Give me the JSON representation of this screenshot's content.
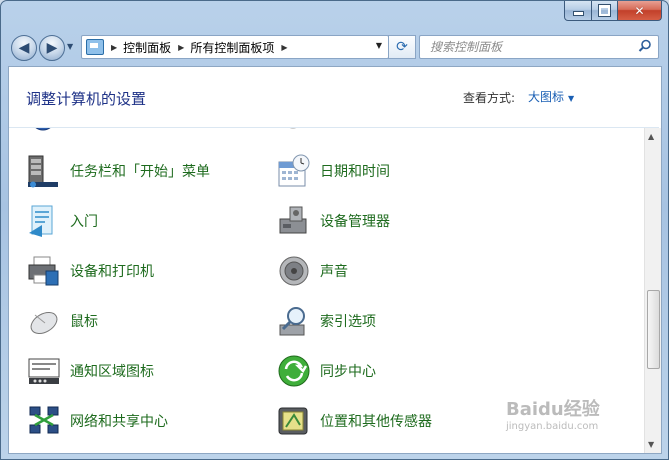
{
  "window": {
    "controls": {
      "minimize": "minimize-icon",
      "maximize": "maximize-icon",
      "close": "close-icon"
    }
  },
  "navigation": {
    "back_icon": "back-arrow-icon",
    "forward_icon": "forward-arrow-icon",
    "breadcrumb": [
      "控制面板",
      "所有控制面板项"
    ],
    "search_placeholder": "搜索控制面板"
  },
  "header": {
    "title": "调整计算机的设置",
    "view_by_label": "查看方式:",
    "view_by_value": "大图标"
  },
  "items": [
    {
      "label": "任务栏和「开始」菜单",
      "icon": "taskbar-icon"
    },
    {
      "label": "日期和时间",
      "icon": "calendar-clock-icon"
    },
    {
      "label": "入门",
      "icon": "getting-started-icon"
    },
    {
      "label": "设备管理器",
      "icon": "device-manager-icon"
    },
    {
      "label": "设备和打印机",
      "icon": "printer-icon"
    },
    {
      "label": "声音",
      "icon": "speaker-icon"
    },
    {
      "label": "鼠标",
      "icon": "mouse-icon"
    },
    {
      "label": "索引选项",
      "icon": "indexing-icon"
    },
    {
      "label": "通知区域图标",
      "icon": "notification-area-icon"
    },
    {
      "label": "同步中心",
      "icon": "sync-center-icon"
    },
    {
      "label": "网络和共享中心",
      "icon": "network-icon"
    },
    {
      "label": "位置和其他传感器",
      "icon": "location-sensor-icon"
    }
  ],
  "watermark": {
    "text": "Baidu经验",
    "sub": "jingyan.baidu.com"
  },
  "colors": {
    "link_green": "#1e6b1e",
    "title_blue": "#1e3287",
    "accent_blue": "#1a5fb4"
  }
}
